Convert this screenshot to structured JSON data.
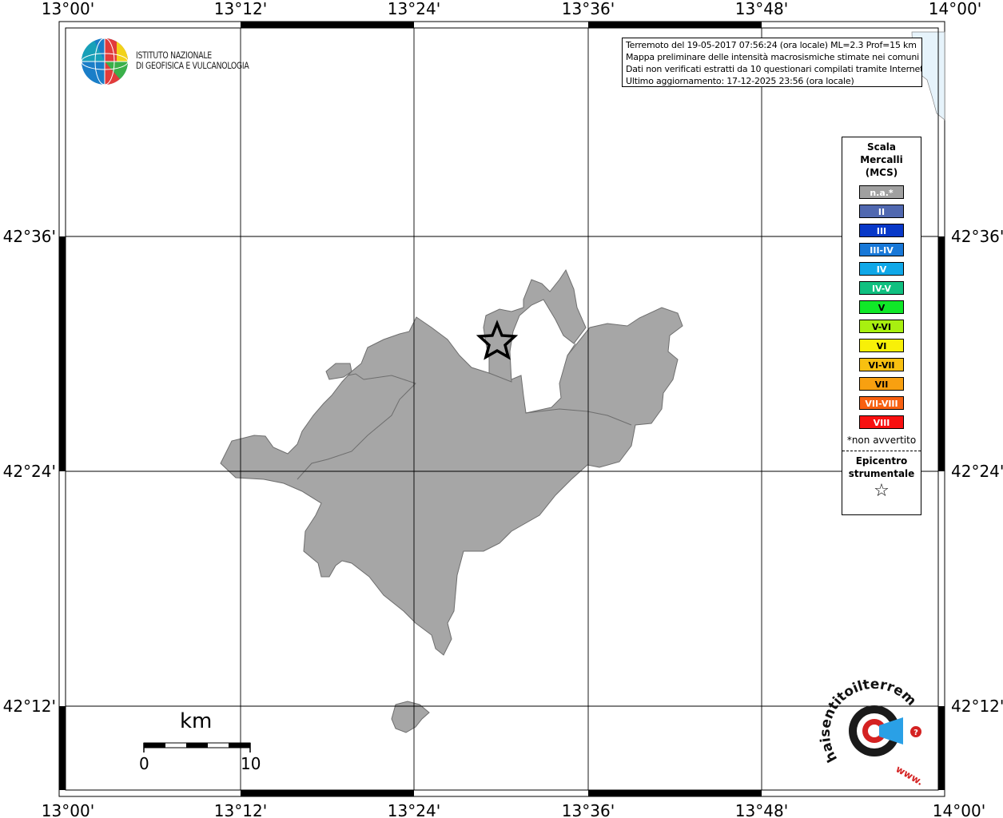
{
  "map": {
    "lon_ticks_top": [
      "13°00'",
      "13°12'",
      "13°24'",
      "13°36'",
      "13°48'",
      "14°00'"
    ],
    "lon_ticks_bottom": [
      "13°00'",
      "13°12'",
      "13°24'",
      "13°36'",
      "13°48'",
      "14°00'"
    ],
    "lat_ticks_left": [
      "42°36'",
      "42°24'",
      "42°12'"
    ],
    "lat_ticks_right": [
      "42°36'",
      "42°24'",
      "42°12'"
    ],
    "region_fill_color": "#a6a6a6",
    "sea_color": "#e6f3fb"
  },
  "institute": {
    "line1": "ISTITUTO NAZIONALE",
    "line2": "DI GEOFISICA E VULCANOLOGIA"
  },
  "info": {
    "line1": "Terremoto del 19-05-2017 07:56:24 (ora locale) ML=2.3 Prof=15 km",
    "line2": "Mappa preliminare delle intensità macrosismiche stimate nei comuni",
    "line3": "Dati non verificati estratti da 10 questionari compilati tramite Internet.",
    "line4": "Ultimo aggiornamento: 17-12-2025 23:56 (ora locale)"
  },
  "legend": {
    "title_line1": "Scala",
    "title_line2": "Mercalli",
    "title_line3": "(MCS)",
    "items": [
      {
        "label": "n.a.*",
        "color": "#a0a0a0"
      },
      {
        "label": "II",
        "color": "#5068b0"
      },
      {
        "label": "III",
        "color": "#0838c8"
      },
      {
        "label": "III-IV",
        "color": "#1878d8"
      },
      {
        "label": "IV",
        "color": "#10a8e8"
      },
      {
        "label": "IV-V",
        "color": "#10c080"
      },
      {
        "label": "V",
        "color": "#10e828"
      },
      {
        "label": "V-VI",
        "color": "#a8f010"
      },
      {
        "label": "VI",
        "color": "#f8f008"
      },
      {
        "label": "VI-VII",
        "color": "#f8c010"
      },
      {
        "label": "VII",
        "color": "#f8a010"
      },
      {
        "label": "VII-VIII",
        "color": "#f86010"
      },
      {
        "label": "VIII",
        "color": "#f81010"
      }
    ],
    "note": "*non avvertito",
    "epicenter_line1": "Epicentro",
    "epicenter_line2": "strumentale",
    "epicenter_symbol": "☆"
  },
  "scale_bar": {
    "unit": "km",
    "start": "0",
    "end": "10"
  },
  "hst": {
    "text": "haisentitoilterremoto.it",
    "www": "www."
  },
  "icons": {
    "ingv_logo": "globe-logo-icon",
    "epicenter": "star-icon",
    "hst_logo": "target-megaphone-icon"
  }
}
